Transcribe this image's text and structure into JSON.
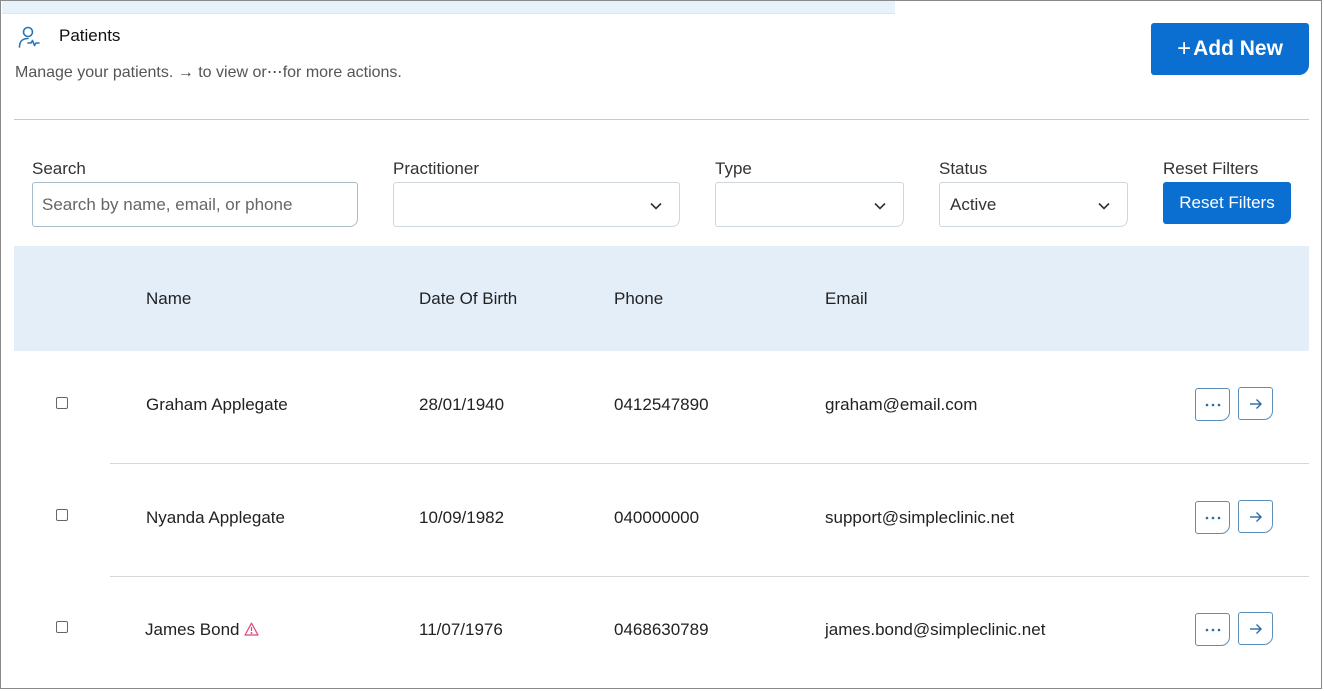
{
  "header": {
    "title": "Patients",
    "subtitle_before": "Manage your patients.",
    "subtitle_arrow": "→",
    "subtitle_middle": "to view or",
    "subtitle_dots": "⋯",
    "subtitle_after": "for more actions.",
    "add_plus": "+",
    "add_label": "Add New"
  },
  "filters": {
    "search_label": "Search",
    "search_placeholder": "Search by name, email, or phone",
    "search_value": "",
    "practitioner_label": "Practitioner",
    "practitioner_value": "",
    "type_label": "Type",
    "type_value": "",
    "status_label": "Status",
    "status_value": "Active",
    "reset_label": "Reset Filters",
    "reset_button": "Reset Filters"
  },
  "table": {
    "columns": [
      "Name",
      "Date Of Birth",
      "Phone",
      "Email"
    ],
    "rows": [
      {
        "name": "Graham Applegate",
        "dob": "28/01/1940",
        "phone": "0412547890",
        "email": "graham@email.com",
        "warning": false
      },
      {
        "name": "Nyanda Applegate",
        "dob": "10/09/1982",
        "phone": "040000000",
        "email": "support@simpleclinic.net",
        "warning": false
      },
      {
        "name": "James Bond",
        "dob": "11/07/1976",
        "phone": "0468630789",
        "email": "james.bond@simpleclinic.net",
        "warning": true
      }
    ]
  },
  "colors": {
    "accent": "#0a6fd0",
    "table_header_bg": "#e3eef9",
    "warning": "#e0457b"
  }
}
